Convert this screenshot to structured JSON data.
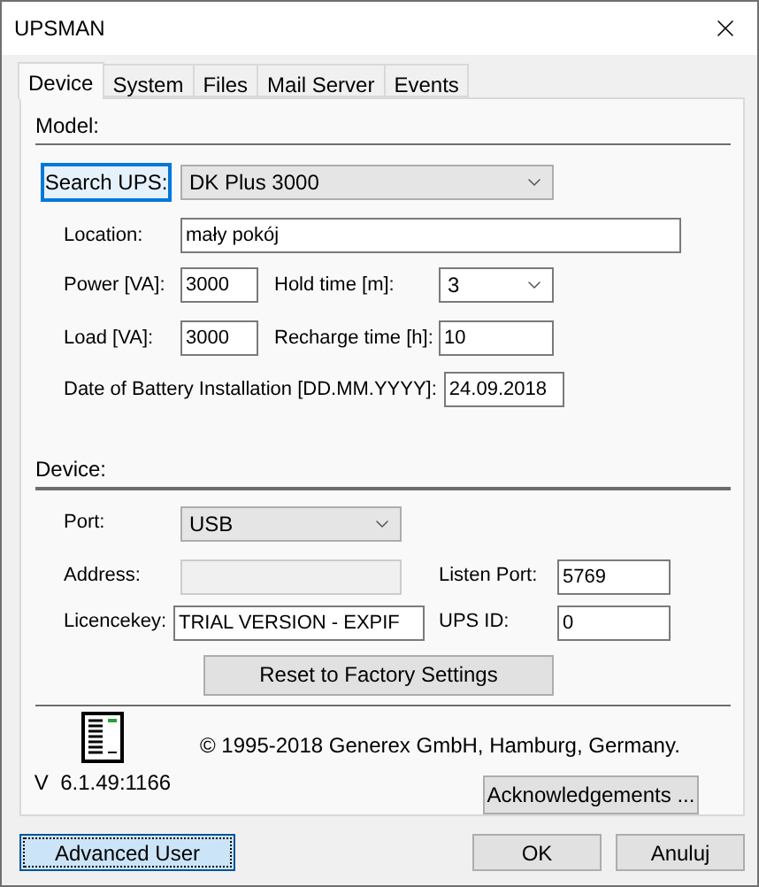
{
  "window": {
    "title": "UPSMAN"
  },
  "tabs": [
    {
      "label": "Device",
      "selected": true
    },
    {
      "label": "System",
      "selected": false
    },
    {
      "label": "Files",
      "selected": false
    },
    {
      "label": "Mail Server",
      "selected": false
    },
    {
      "label": "Events",
      "selected": false
    }
  ],
  "model_section": {
    "heading": "Model:",
    "search_button": {
      "label": "Search UPS:",
      "focused": true
    },
    "model": "DK Plus 3000",
    "location": {
      "label": "Location:",
      "value": "mały pokój"
    },
    "power": {
      "label": "Power [VA]:",
      "value": "3000"
    },
    "hold_time": {
      "label": "Hold time [m]:",
      "value": "3"
    },
    "load": {
      "label": "Load [VA]:",
      "value": "3000"
    },
    "recharge_time": {
      "label": "Recharge time [h]:",
      "value": "10"
    },
    "battery_date": {
      "label": "Date of Battery Installation [DD.MM.YYYY]:",
      "value": "24.09.2018"
    }
  },
  "device_section": {
    "heading": "Device:",
    "port": {
      "label": "Port:",
      "value": "USB"
    },
    "address": {
      "label": "Address:",
      "disabled": true
    },
    "listen_port": {
      "label": "Listen Port:",
      "value": "5769"
    },
    "licencekey": {
      "label": "Licencekey:",
      "value": "TRIAL VERSION - EXPIF"
    },
    "ups_id": {
      "label": "UPS ID:",
      "value": "0"
    },
    "reset_button": "Reset to Factory Settings"
  },
  "about": {
    "copyright": "© 1995-2018 Generex GmbH, Hamburg, Germany.",
    "version": "V  6.1.49:1166",
    "acknowledgements_button": "Acknowledgements ..."
  },
  "buttons": [
    {
      "label": "Advanced User",
      "focused": true
    },
    {
      "label": "OK",
      "focused": false
    },
    {
      "label": "Anuluj",
      "focused": false
    }
  ]
}
